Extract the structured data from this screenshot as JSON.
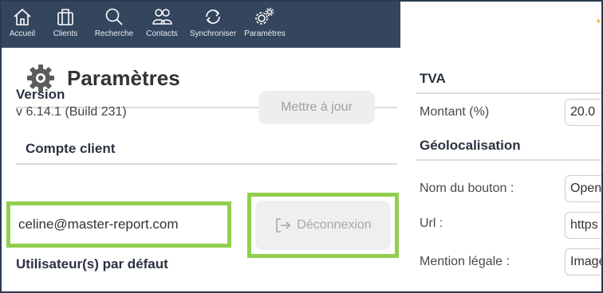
{
  "nav": {
    "items": [
      {
        "label": "Accueil",
        "icon": "home-icon"
      },
      {
        "label": "Clients",
        "icon": "briefcase-icon"
      },
      {
        "label": "Recherche",
        "icon": "search-icon"
      },
      {
        "label": "Contacts",
        "icon": "contacts-icon"
      },
      {
        "label": "Synchroniser",
        "icon": "sync-icon"
      },
      {
        "label": "Paramètres",
        "icon": "gears-icon"
      }
    ]
  },
  "page": {
    "title": "Paramètres",
    "title_icon": "gear-icon"
  },
  "left": {
    "version_heading": "Version",
    "version_value": "v 6.14.1 (Build 231)",
    "update_button": "Mettre à jour",
    "account_heading": "Compte client",
    "email": "celine@master-report.com",
    "logout_button": "Déconnexion",
    "logout_icon": "logout-icon",
    "default_users_heading": "Utilisateur(s) par défaut"
  },
  "right": {
    "tva_heading": "TVA",
    "amount_label": "Montant (%)",
    "amount_value": "20.0",
    "geo_heading": "Géolocalisation",
    "button_name_label": "Nom du bouton :",
    "button_name_value": "Open",
    "url_label": "Url :",
    "url_value": "https",
    "legal_label": "Mention légale :",
    "legal_value": "Image"
  },
  "colors": {
    "topbar": "#34465e",
    "highlight": "#92cf4e",
    "accent_star": "#e8b84a"
  }
}
